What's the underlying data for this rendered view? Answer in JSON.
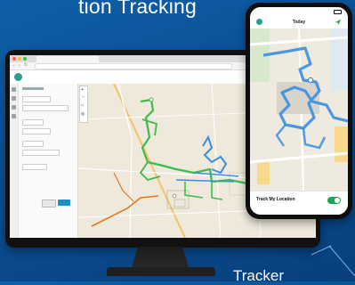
{
  "headline": "tion Tracking",
  "footer_label": "Tracker",
  "desktop": {
    "browser_tab": "",
    "app_name": "",
    "panel": {
      "cancel_label": "",
      "ok_label": ""
    }
  },
  "phone": {
    "status_time": "",
    "nav_title": "Today",
    "track_label": "Track My Location",
    "track_subtitle": "",
    "tracking_enabled": true
  },
  "colors": {
    "background": "#0b4f93",
    "track_green": "#3dbb4e",
    "track_blue": "#3a8ee0",
    "track_orange": "#e07a1f",
    "toggle_on": "#23a455"
  }
}
